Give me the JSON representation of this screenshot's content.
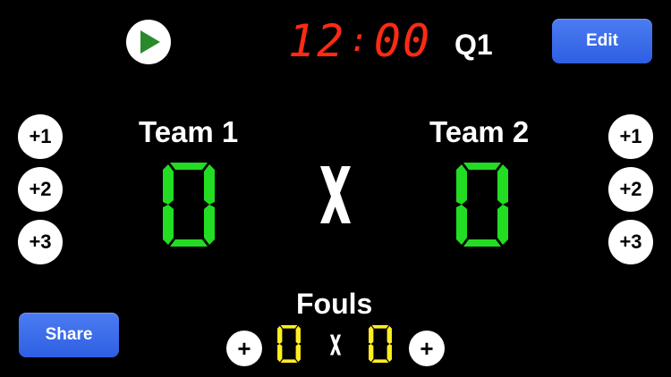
{
  "controls": {
    "play_icon": "play-triangle",
    "edit_label": "Edit",
    "share_label": "Share"
  },
  "clock": {
    "minutes": "12",
    "separator": ":",
    "seconds": "00"
  },
  "period": "Q1",
  "teams": [
    {
      "name": "Team 1",
      "score": 0,
      "fouls": 0
    },
    {
      "name": "Team 2",
      "score": 0,
      "fouls": 0
    }
  ],
  "score_buttons": [
    "+1",
    "+2",
    "+3"
  ],
  "versus_symbol": "X",
  "fouls": {
    "label": "Fouls",
    "add_label": "+",
    "separator": "X"
  },
  "colors": {
    "background": "#000000",
    "clock": "#ff2a14",
    "score": "#22dd22",
    "fouls": "#ffee22",
    "button_blue": "#3a6ce8"
  }
}
